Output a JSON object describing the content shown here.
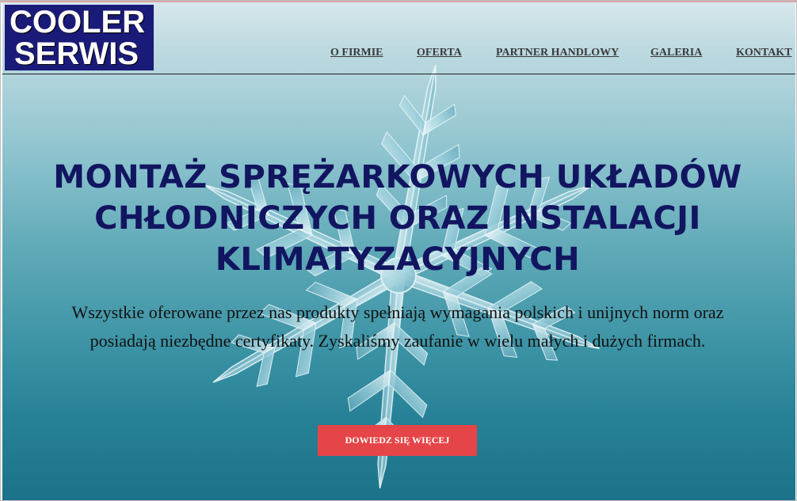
{
  "logo": {
    "line1": "COOLER",
    "line2": "SERWIS"
  },
  "nav": {
    "items": [
      {
        "label": "O FIRMIE"
      },
      {
        "label": "OFERTA"
      },
      {
        "label": "PARTNER HANDLOWY"
      },
      {
        "label": "GALERIA"
      },
      {
        "label": "KONTAKT"
      }
    ]
  },
  "hero": {
    "title": "MONTAŻ SPRĘŻARKOWYCH UKŁADÓW CHŁODNICZYCH ORAZ INSTALACJI KLIMATYZACYJNYCH",
    "description": "Wszystkie oferowane przez nas produkty spełniają wymagania polskich i unijnych norm oraz posiadają niezbędne certyfikaty. Zyskaliśmy zaufanie w wielu małych i dużych firmach.",
    "cta_label": "DOWIEDZ SIĘ WIĘCEJ"
  },
  "colors": {
    "logo_bg": "#1a1a78",
    "title": "#121560",
    "cta_bg": "#e54548",
    "hero_top": "#d7e7ec",
    "hero_bottom": "#1c7389"
  },
  "icons": {
    "background_image": "snowflake-icon"
  }
}
